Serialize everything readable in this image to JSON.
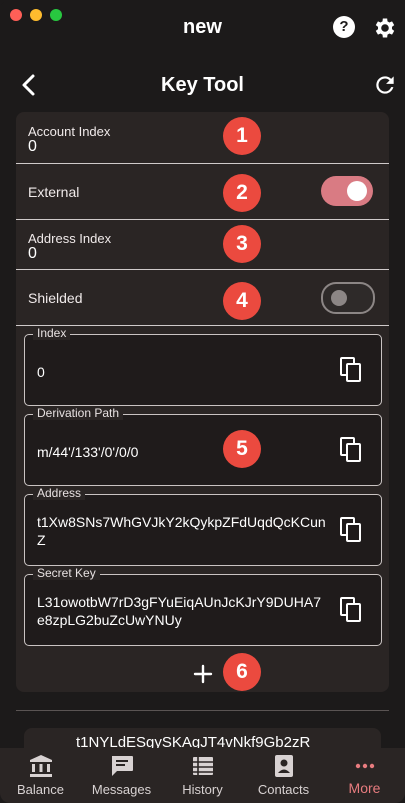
{
  "app": {
    "title": "new"
  },
  "page": {
    "title": "Key Tool"
  },
  "rows": {
    "account_index": {
      "label": "Account Index",
      "value": "0"
    },
    "external": {
      "label": "External",
      "on": true
    },
    "address_index": {
      "label": "Address Index",
      "value": "0"
    },
    "shielded": {
      "label": "Shielded",
      "on": false
    }
  },
  "fields": {
    "index": {
      "label": "Index",
      "value": "0"
    },
    "derivation_path": {
      "label": "Derivation Path",
      "value": "m/44'/133'/0'/0/0"
    },
    "address": {
      "label": "Address",
      "value": "t1Xw8SNs7WhGVJkY2kQykpZFdUqdQcKCunZ"
    },
    "secret_key": {
      "label": "Secret Key",
      "value": "L31owotbW7rD3gFYuEiqAUnJcKJrY9DUHA7e8zpLG2buZcUwYNUy"
    }
  },
  "badges": [
    "1",
    "2",
    "3",
    "4",
    "5",
    "6"
  ],
  "peek_item": {
    "text": "t1NYLdESgySKAgJT4vNkf9Gb2zR"
  },
  "nav": {
    "balance": "Balance",
    "messages": "Messages",
    "history": "History",
    "contacts": "Contacts",
    "more": "More"
  },
  "colors": {
    "accent": "#e87c7f",
    "badge": "#eb4a3f",
    "toggle_on": "#d97b83",
    "background": "#1c1a1a",
    "card": "#2a2524"
  }
}
